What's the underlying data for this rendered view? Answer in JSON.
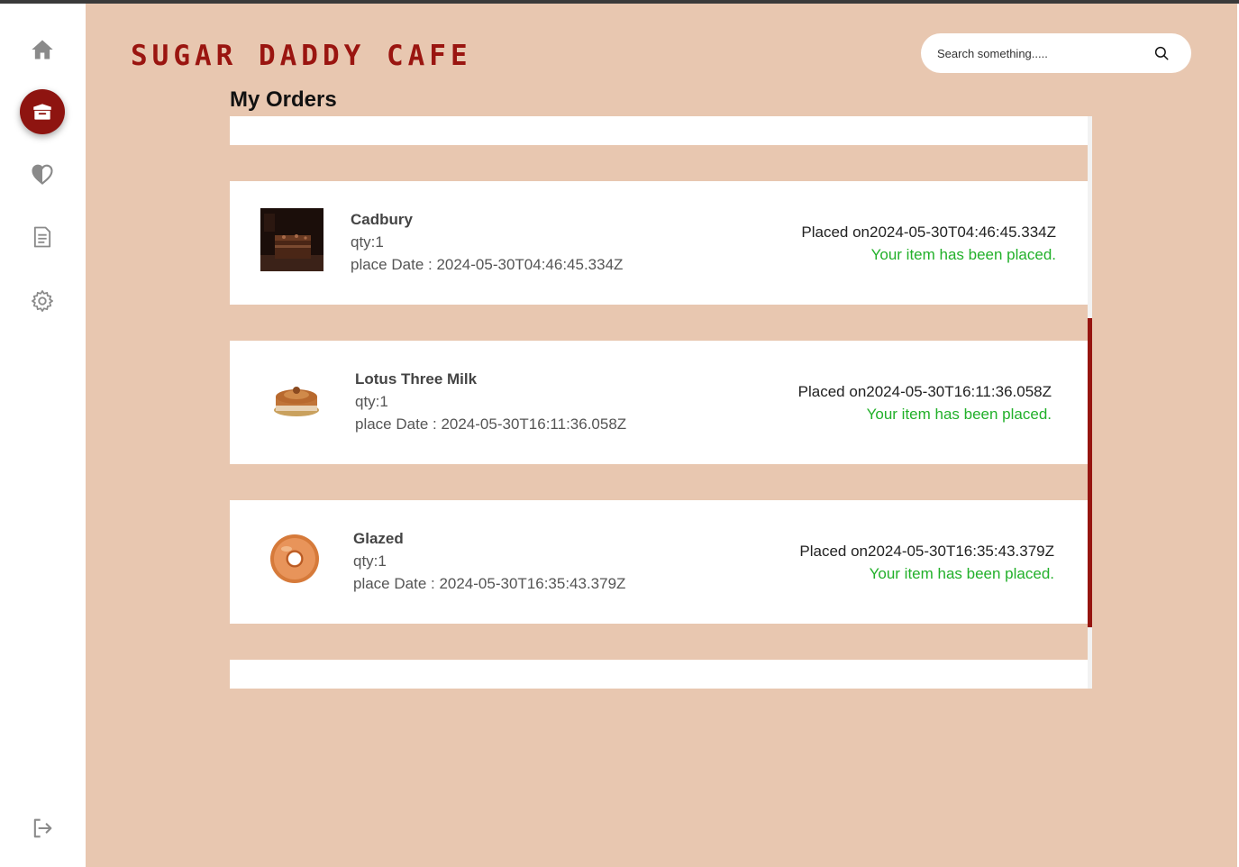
{
  "brand": {
    "name": "SUGAR DADDY CAFE",
    "color": "#9a1510"
  },
  "search": {
    "placeholder": "Search something....."
  },
  "page": {
    "title": "My Orders"
  },
  "sidebar": {
    "items": [
      {
        "name": "home",
        "icon": "home-icon",
        "active": false
      },
      {
        "name": "orders",
        "icon": "box-icon",
        "active": true
      },
      {
        "name": "favorites",
        "icon": "heart-icon",
        "active": false
      },
      {
        "name": "documents",
        "icon": "document-icon",
        "active": false
      },
      {
        "name": "settings",
        "icon": "gear-icon",
        "active": false
      }
    ],
    "footer": {
      "name": "logout",
      "icon": "logout-icon"
    }
  },
  "orders": [
    {
      "name": "Cadbury",
      "qty": "qty:1",
      "place_date": "place Date : 2024-05-30T04:46:45.334Z",
      "placed_on": "Placed on2024-05-30T04:46:45.334Z",
      "status_message": "Your item has been placed.",
      "image": "brownie-image"
    },
    {
      "name": "Lotus Three Milk",
      "qty": "qty:1",
      "place_date": "place Date : 2024-05-30T16:11:36.058Z",
      "placed_on": "Placed on2024-05-30T16:11:36.058Z",
      "status_message": "Your item has been placed.",
      "image": "cake-image"
    },
    {
      "name": "Glazed",
      "qty": "qty:1",
      "place_date": "place Date : 2024-05-30T16:35:43.379Z",
      "placed_on": "Placed on2024-05-30T16:35:43.379Z",
      "status_message": "Your item has been placed.",
      "image": "donut-image"
    }
  ],
  "colors": {
    "background": "#e8c7b0",
    "accent": "#8e1410",
    "status_green": "#22b02a"
  }
}
